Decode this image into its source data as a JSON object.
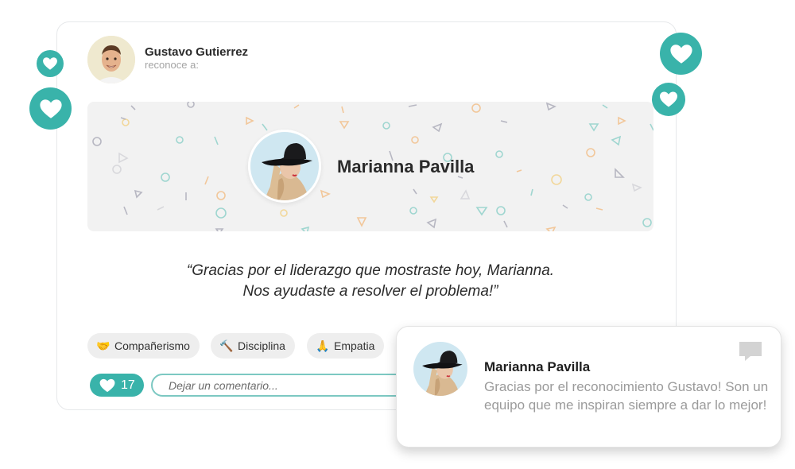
{
  "post": {
    "author_name": "Gustavo Gutierrez",
    "author_subtitle": "reconoce a:",
    "recipient_name": "Marianna Pavilla",
    "quote_line1": "“Gracias por el liderazgo que mostraste hoy, Marianna.",
    "quote_line2": "Nos ayudaste a resolver el problema!”"
  },
  "tags": [
    {
      "emoji": "🤝",
      "label": "Compañerismo"
    },
    {
      "emoji": "🔨",
      "label": "Disciplina"
    },
    {
      "emoji": "🙏",
      "label": "Empatia"
    }
  ],
  "footer": {
    "like_count": "17",
    "comment_placeholder": "Dejar un comentario..."
  },
  "reply": {
    "name": "Marianna Pavilla",
    "message": "Gracias por el reconocimiento Gustavo! Son un equipo que me inspiran siempre a dar lo mejor!"
  },
  "colors": {
    "accent": "#39b3aa",
    "input_border": "#7cc8c2",
    "banner_bg": "#f2f2f2"
  },
  "icons": {
    "heart": "heart-icon",
    "chat": "chat-bubble-icon"
  }
}
